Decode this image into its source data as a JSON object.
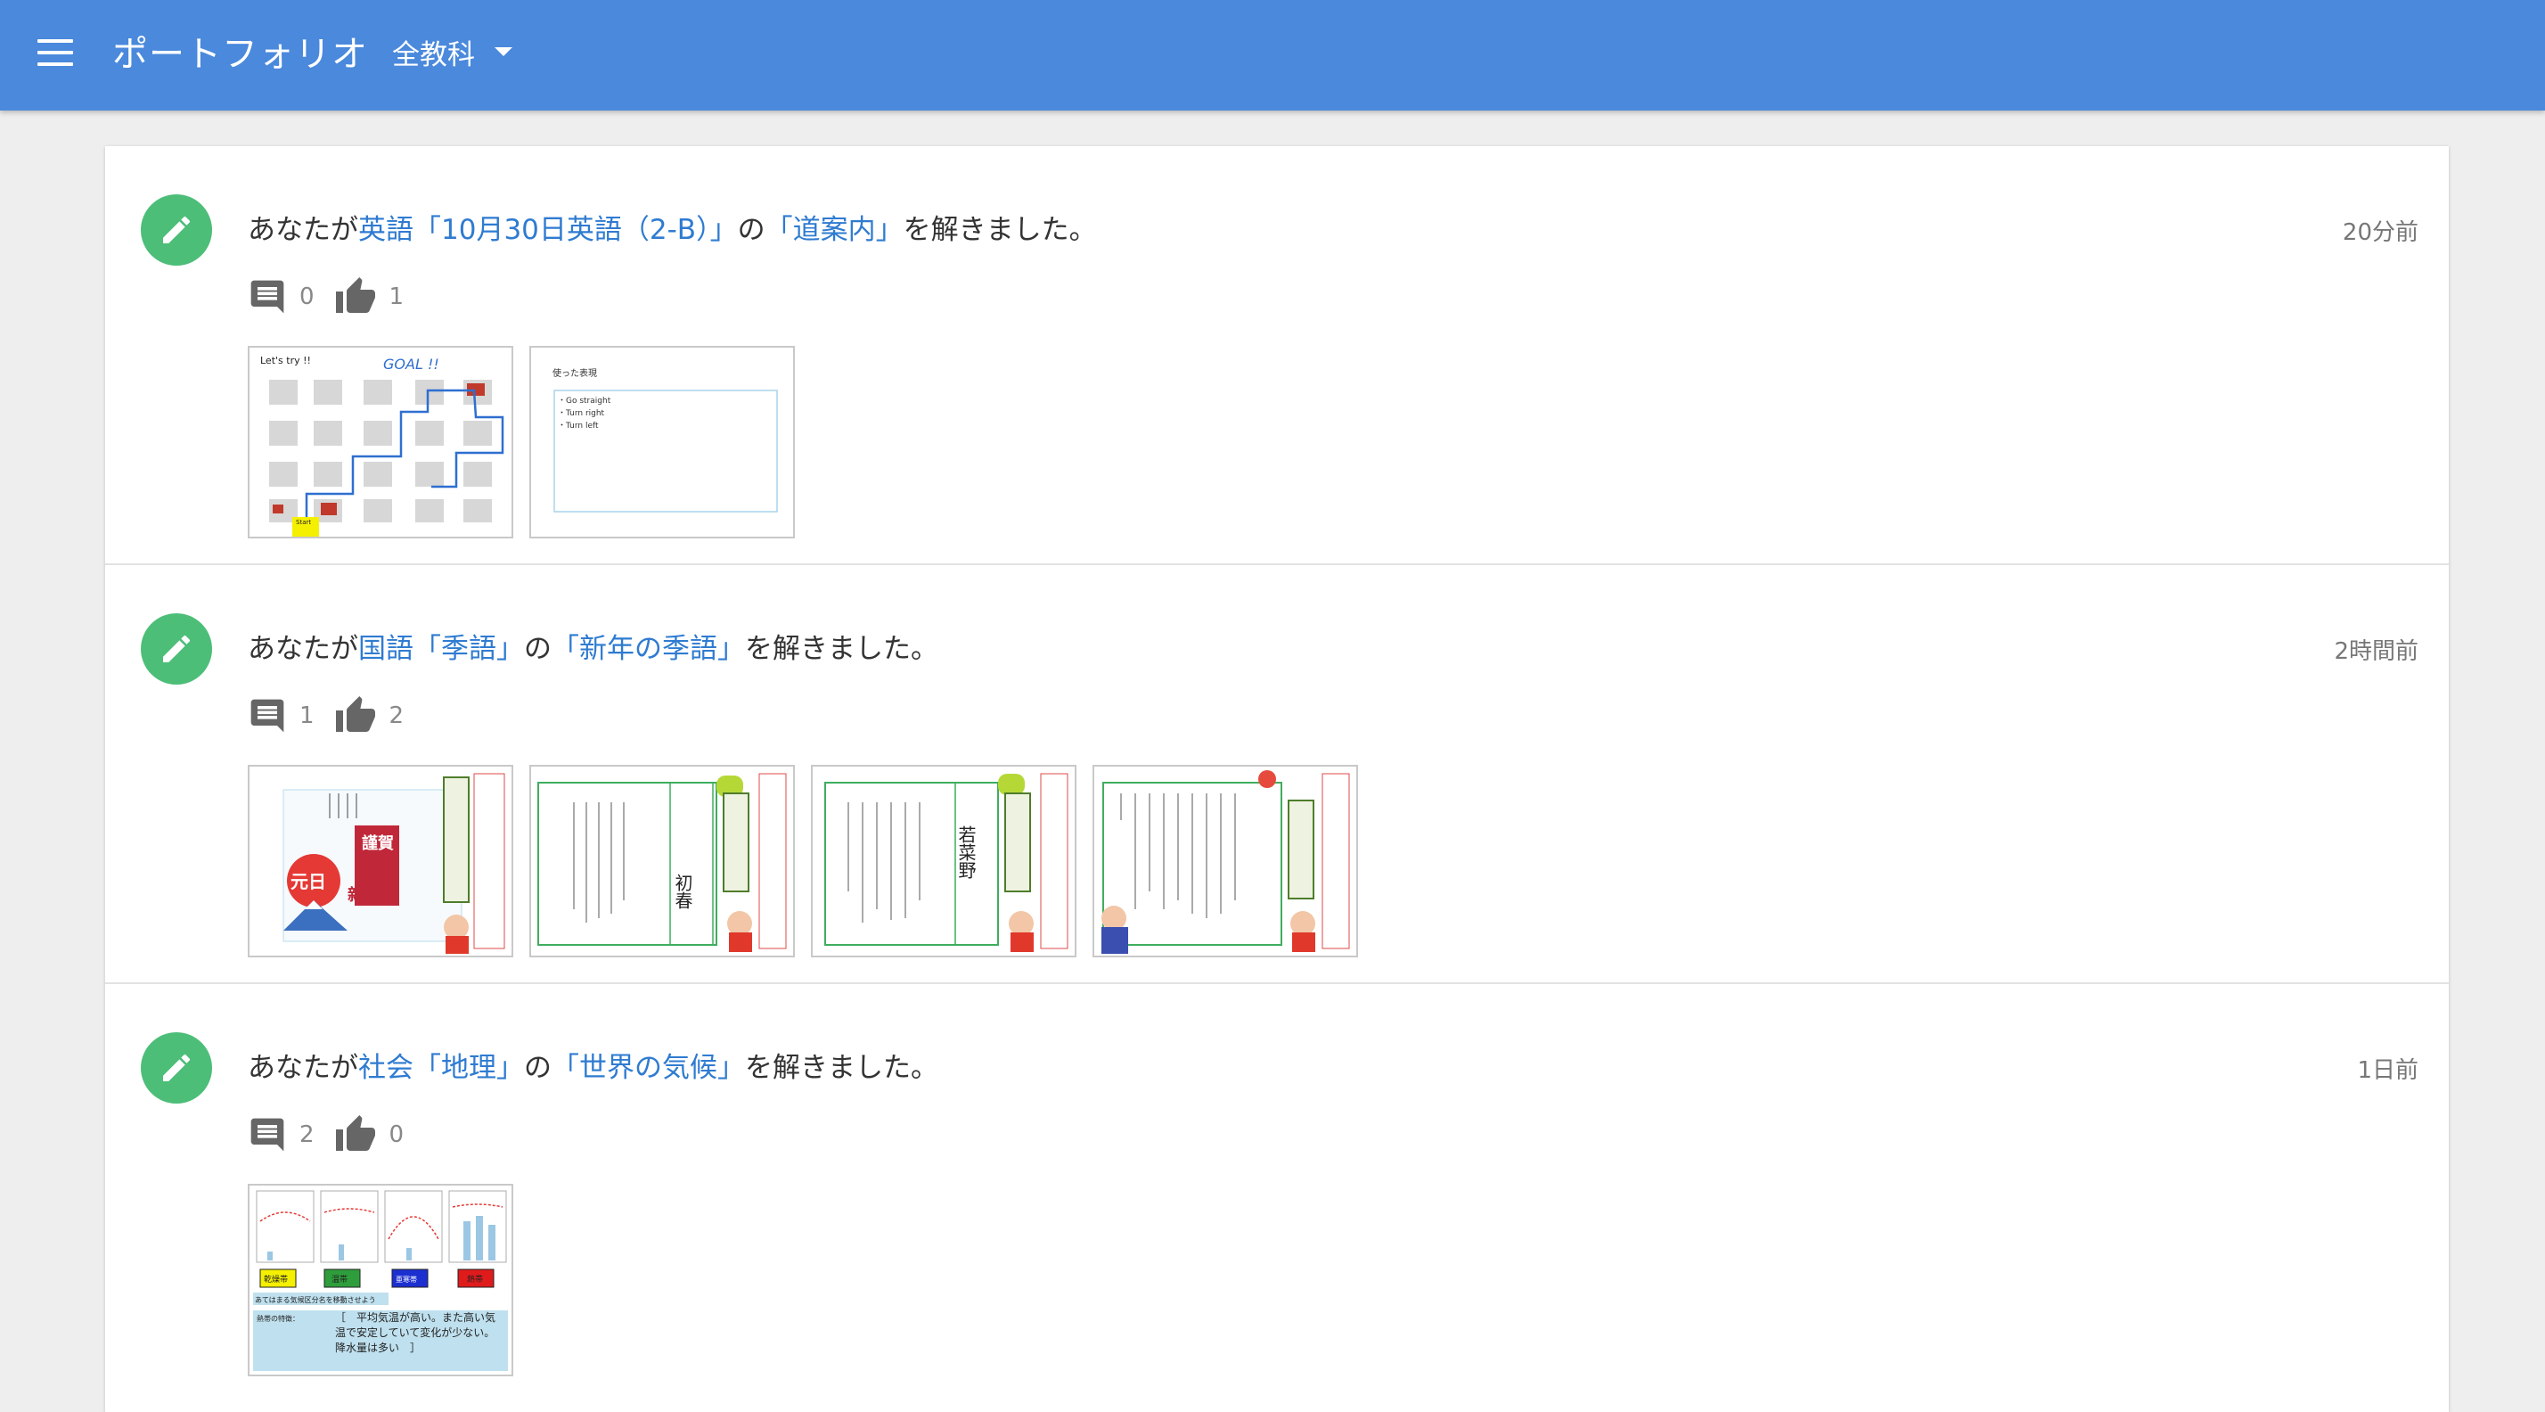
{
  "app": {
    "title": "ポートフォリオ",
    "subject_filter": "全教科",
    "colors": {
      "appbar": "#4a89dc",
      "avatar": "#4cbe78",
      "link": "#2f7bd1"
    }
  },
  "activities": [
    {
      "prefix": "あなたが",
      "subject": "英語",
      "unit": "「10月30日英語（2-B）」",
      "particle": "の",
      "lesson": "「道案内」",
      "suffix": "を解きました。",
      "time": "20分前",
      "comments": "0",
      "likes": "1",
      "thumbs": [
        {
          "title": "Let's try !!",
          "goal": "GOAL !!",
          "start": "Start"
        },
        {
          "title": "使った表現",
          "lines": [
            "・Go straight",
            "・Turn right",
            "・Turn left"
          ]
        }
      ]
    },
    {
      "prefix": "あなたが",
      "subject": "国語",
      "unit": "「季語」",
      "particle": "の",
      "lesson": "「新年の季語」",
      "suffix": "を解きました。",
      "time": "2時間前",
      "comments": "1",
      "likes": "2",
      "thumbs": [
        {
          "big1": "謹賀",
          "big2": "新年",
          "big3": "元日"
        },
        {
          "word": "初春"
        },
        {
          "word": "若菜野"
        },
        {
          "word": ""
        }
      ]
    },
    {
      "prefix": "あなたが",
      "subject": "社会",
      "unit": "「地理」",
      "particle": "の",
      "lesson": "「世界の気候」",
      "suffix": "を解きました。",
      "time": "1日前",
      "comments": "2",
      "likes": "0",
      "thumbs": [
        {
          "labels": [
            "乾燥帯",
            "温帯",
            "亜寒帯",
            "熱帯"
          ],
          "caption": "あてはまる気候区分名を移動させよう",
          "feature_label": "熱帯の特徴：",
          "feature_text": "［　平均気温が高い。また高い気温で安定していて変化が少ない。降水量は多い　］"
        }
      ]
    }
  ]
}
